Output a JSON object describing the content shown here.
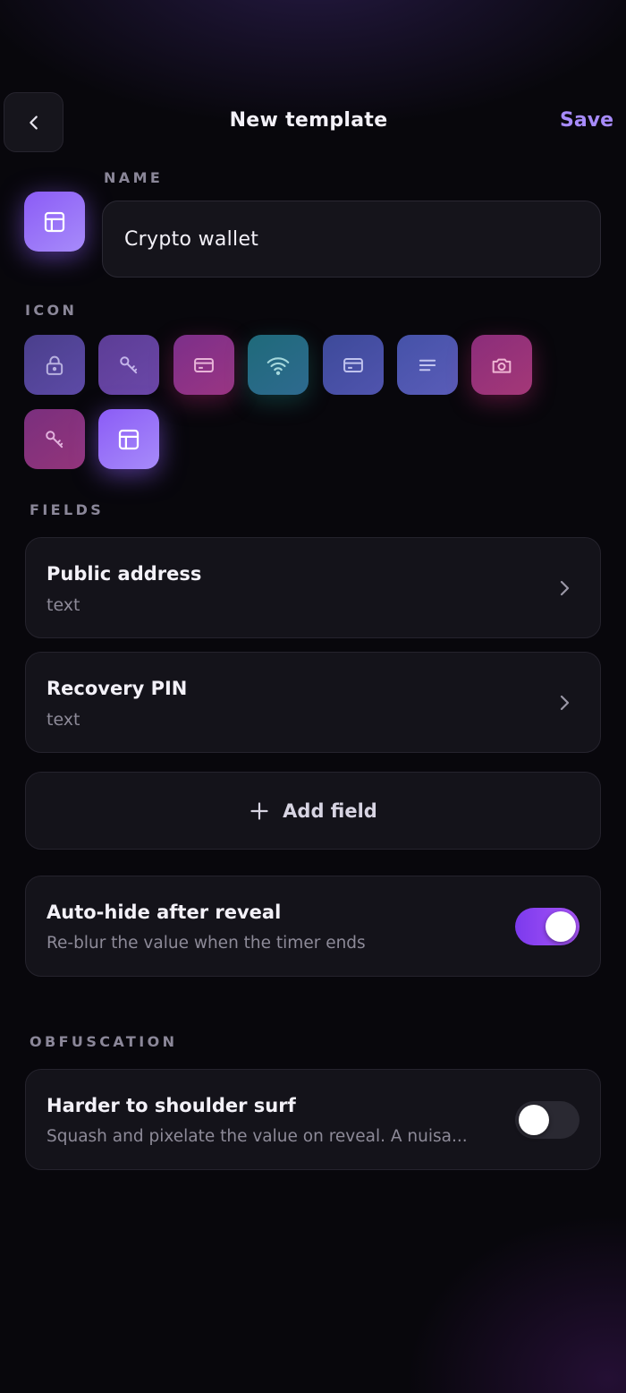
{
  "header": {
    "title": "New template",
    "save_label": "Save"
  },
  "name_section": {
    "label": "NAME",
    "value": "Crypto wallet"
  },
  "icon_section": {
    "label": "ICON",
    "icons": [
      {
        "name": "lock-icon"
      },
      {
        "name": "key-icon"
      },
      {
        "name": "credit-card-icon"
      },
      {
        "name": "wifi-icon"
      },
      {
        "name": "credit-card-icon"
      },
      {
        "name": "notes-icon"
      },
      {
        "name": "camera-icon"
      },
      {
        "name": "key-icon"
      },
      {
        "name": "template-icon",
        "selected": true
      }
    ]
  },
  "fields_section": {
    "label": "FIELDS",
    "fields": [
      {
        "name": "Public address",
        "type": "text"
      },
      {
        "name": "Recovery PIN",
        "type": "text"
      }
    ],
    "add_label": "Add field"
  },
  "auto_hide": {
    "title": "Auto-hide after reveal",
    "description": "Re-blur the value when the timer ends",
    "enabled": true
  },
  "obfuscation": {
    "label": "OBFUSCATION",
    "title": "Harder to shoulder surf",
    "description": "Squash and pixelate the value on reveal. A nuisa...",
    "enabled": false
  },
  "colors": {
    "accent": "#a78bfa",
    "toggle_on": "#8b5cf6",
    "background": "#08070c"
  }
}
